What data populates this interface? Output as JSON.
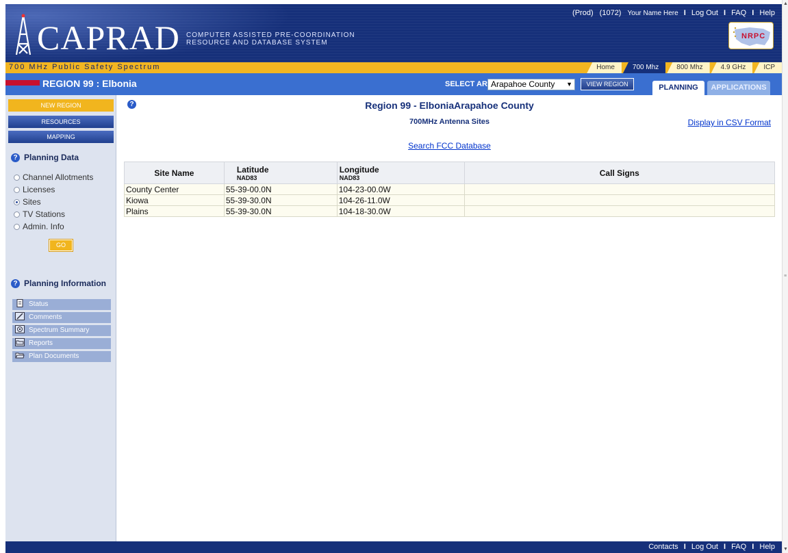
{
  "header": {
    "top_links": {
      "env": "(Prod)",
      "user_id": "(1072)",
      "user_name": "Your Name Here",
      "logout": "Log Out",
      "faq": "FAQ",
      "help": "Help"
    },
    "logo_title": "CAPRAD",
    "logo_subtitle_line1": "COMPUTER ASSISTED PRE-COORDINATION",
    "logo_subtitle_line2": "RESOURCE AND DATABASE SYSTEM",
    "nrpc_logo": "NRPC",
    "spectrum_label": "700 MHz Public Safety Spectrum",
    "bands": [
      {
        "label": "Home",
        "active": false
      },
      {
        "label": "700 Mhz",
        "active": true
      },
      {
        "label": "800 Mhz",
        "active": false
      },
      {
        "label": "4.9 GHz",
        "active": false
      },
      {
        "label": "ICP",
        "active": false
      }
    ]
  },
  "region_bar": {
    "region_title": "REGION 99 : Elbonia",
    "select_label": "SELECT AREA:",
    "selected_area": "Arapahoe County",
    "view_region_button": "VIEW REGION",
    "tabs": {
      "planning": "PLANNING",
      "applications": "APPLICATIONS"
    }
  },
  "sidebar": {
    "new_region": "NEW REGION",
    "resources": "RESOURCES",
    "mapping": "MAPPING",
    "planning_data_heading": "Planning Data",
    "planning_data_options": [
      {
        "label": "Channel Allotments",
        "selected": false
      },
      {
        "label": "Licenses",
        "selected": false
      },
      {
        "label": "Sites",
        "selected": true
      },
      {
        "label": "TV Stations",
        "selected": false
      },
      {
        "label": "Admin. Info",
        "selected": false
      }
    ],
    "go_button": "GO",
    "planning_info_heading": "Planning Information",
    "planning_info_items": [
      {
        "label": "Status",
        "icon": "document-icon"
      },
      {
        "label": "Comments",
        "icon": "pencil-icon"
      },
      {
        "label": "Spectrum Summary",
        "icon": "spectrum-icon"
      },
      {
        "label": "Reports",
        "icon": "folder-icon"
      },
      {
        "label": "Plan Documents",
        "icon": "folder-open-icon"
      }
    ]
  },
  "main": {
    "title": "Region 99 - ElboniaArapahoe County",
    "subtitle": "700MHz Antenna Sites",
    "csv_link": "Display in CSV Format",
    "fcc_link": "Search FCC Database",
    "table": {
      "headers": {
        "site_name": "Site Name",
        "latitude": "Latitude",
        "latitude_sub": "NAD83",
        "longitude": "Longitude",
        "longitude_sub": "NAD83",
        "call_signs": "Call Signs"
      },
      "rows": [
        {
          "site_name": "County Center",
          "latitude": "55-39-00.0N",
          "longitude": "104-23-00.0W",
          "call_signs": ""
        },
        {
          "site_name": "Kiowa",
          "latitude": "55-39-30.0N",
          "longitude": "104-26-11.0W",
          "call_signs": ""
        },
        {
          "site_name": "Plains",
          "latitude": "55-39-30.0N",
          "longitude": "104-18-30.0W",
          "call_signs": ""
        }
      ]
    }
  },
  "footer": {
    "contacts": "Contacts",
    "logout": "Log Out",
    "faq": "FAQ",
    "help": "Help"
  },
  "colors": {
    "navy": "#16307a",
    "accent_blue": "#3a6fd0",
    "gold": "#f2b521",
    "sidebar_bg": "#dde3ef"
  }
}
